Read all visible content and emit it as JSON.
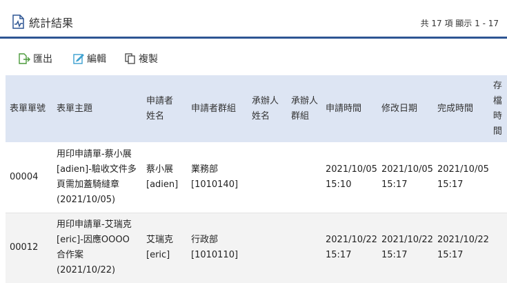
{
  "header": {
    "title": "統計結果",
    "summary": "共 17 項 顯示 1 - 17"
  },
  "toolbar": {
    "export_label": "匯出",
    "edit_label": "編輯",
    "copy_label": "複製"
  },
  "table": {
    "columns": [
      {
        "line1": "表單單號",
        "line2": ""
      },
      {
        "line1": "表單主題",
        "line2": ""
      },
      {
        "line1": "申請者",
        "line2": "姓名"
      },
      {
        "line1": "申請者群組",
        "line2": ""
      },
      {
        "line1": "承辦人",
        "line2": "姓名"
      },
      {
        "line1": "承辦人",
        "line2": "群組"
      },
      {
        "line1": "申請時間",
        "line2": ""
      },
      {
        "line1": "修改日期",
        "line2": ""
      },
      {
        "line1": "完成時間",
        "line2": ""
      },
      {
        "line1": "存檔",
        "line2": "時間"
      }
    ],
    "rows": [
      {
        "form_no": "00004",
        "subject": [
          "用印申請單-蔡小展",
          "[adien]-驗收文件多",
          "頁需加蓋騎縫章",
          "(2021/10/05)"
        ],
        "applicant": [
          "蔡小展",
          "[adien]"
        ],
        "group": [
          "業務部",
          "[1010140]"
        ],
        "handler_name": "",
        "handler_group": "",
        "req_time": [
          "2021/10/05",
          "15:10"
        ],
        "mod_date": [
          "2021/10/05",
          "15:17"
        ],
        "done_time": [
          "2021/10/05",
          "15:17"
        ],
        "archive_time": ""
      },
      {
        "form_no": "00012",
        "subject": [
          "用印申請單-艾瑞克",
          "[eric]-因應OOOO",
          "合作案",
          "(2021/10/22)"
        ],
        "applicant": [
          "艾瑞克",
          "[eric]"
        ],
        "group": [
          "行政部",
          "[1010110]"
        ],
        "handler_name": "",
        "handler_group": "",
        "req_time": [
          "2021/10/22",
          "15:17"
        ],
        "mod_date": [
          "2021/10/22",
          "15:17"
        ],
        "done_time": [
          "2021/10/22",
          "15:17"
        ],
        "archive_time": ""
      }
    ]
  }
}
